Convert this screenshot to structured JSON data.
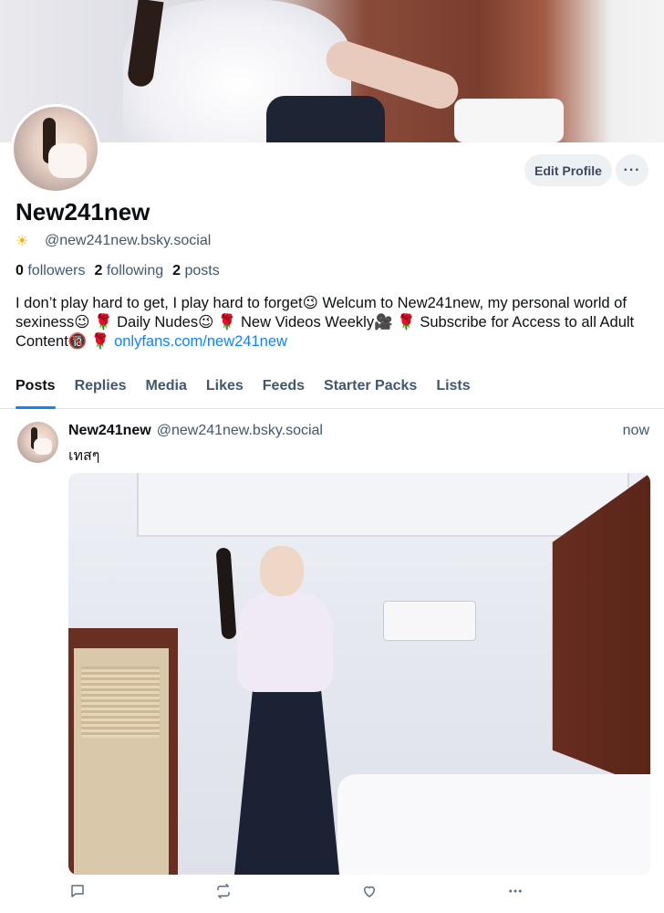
{
  "profile": {
    "display_name": "New241new",
    "handle_icon": "sun-emoji-icon",
    "handle": "@new241new.bsky.social",
    "edit_label": "Edit Profile",
    "more_label": "···",
    "followers_count": "0",
    "followers_label": "followers",
    "following_count": "2",
    "following_label": "following",
    "posts_count": "2",
    "posts_label": "posts",
    "bio_text": "I don’t play hard to get, I play hard to forget😉 Welcum to New241new, my personal world of sexiness😉 🌹 Daily Nudes😉 🌹 New Videos Weekly🎥 🌹 Subscribe for Access to all Adult Content🔞 🌹",
    "bio_link": "onlyfans.com/new241new"
  },
  "tabs": [
    {
      "label": "Posts",
      "active": true
    },
    {
      "label": "Replies",
      "active": false
    },
    {
      "label": "Media",
      "active": false
    },
    {
      "label": "Likes",
      "active": false
    },
    {
      "label": "Feeds",
      "active": false
    },
    {
      "label": "Starter Packs",
      "active": false
    },
    {
      "label": "Lists",
      "active": false
    }
  ],
  "post": {
    "author_name": "New241new",
    "author_handle": "@new241new.bsky.social",
    "time": "now",
    "text": "เทสๆ",
    "image_description": "",
    "actions": [
      "reply-icon",
      "repost-icon",
      "like-icon",
      "more-icon"
    ]
  },
  "colors": {
    "accent": "#1083fe",
    "muted_text": "#42576c",
    "button_bg": "#eef1f4"
  }
}
